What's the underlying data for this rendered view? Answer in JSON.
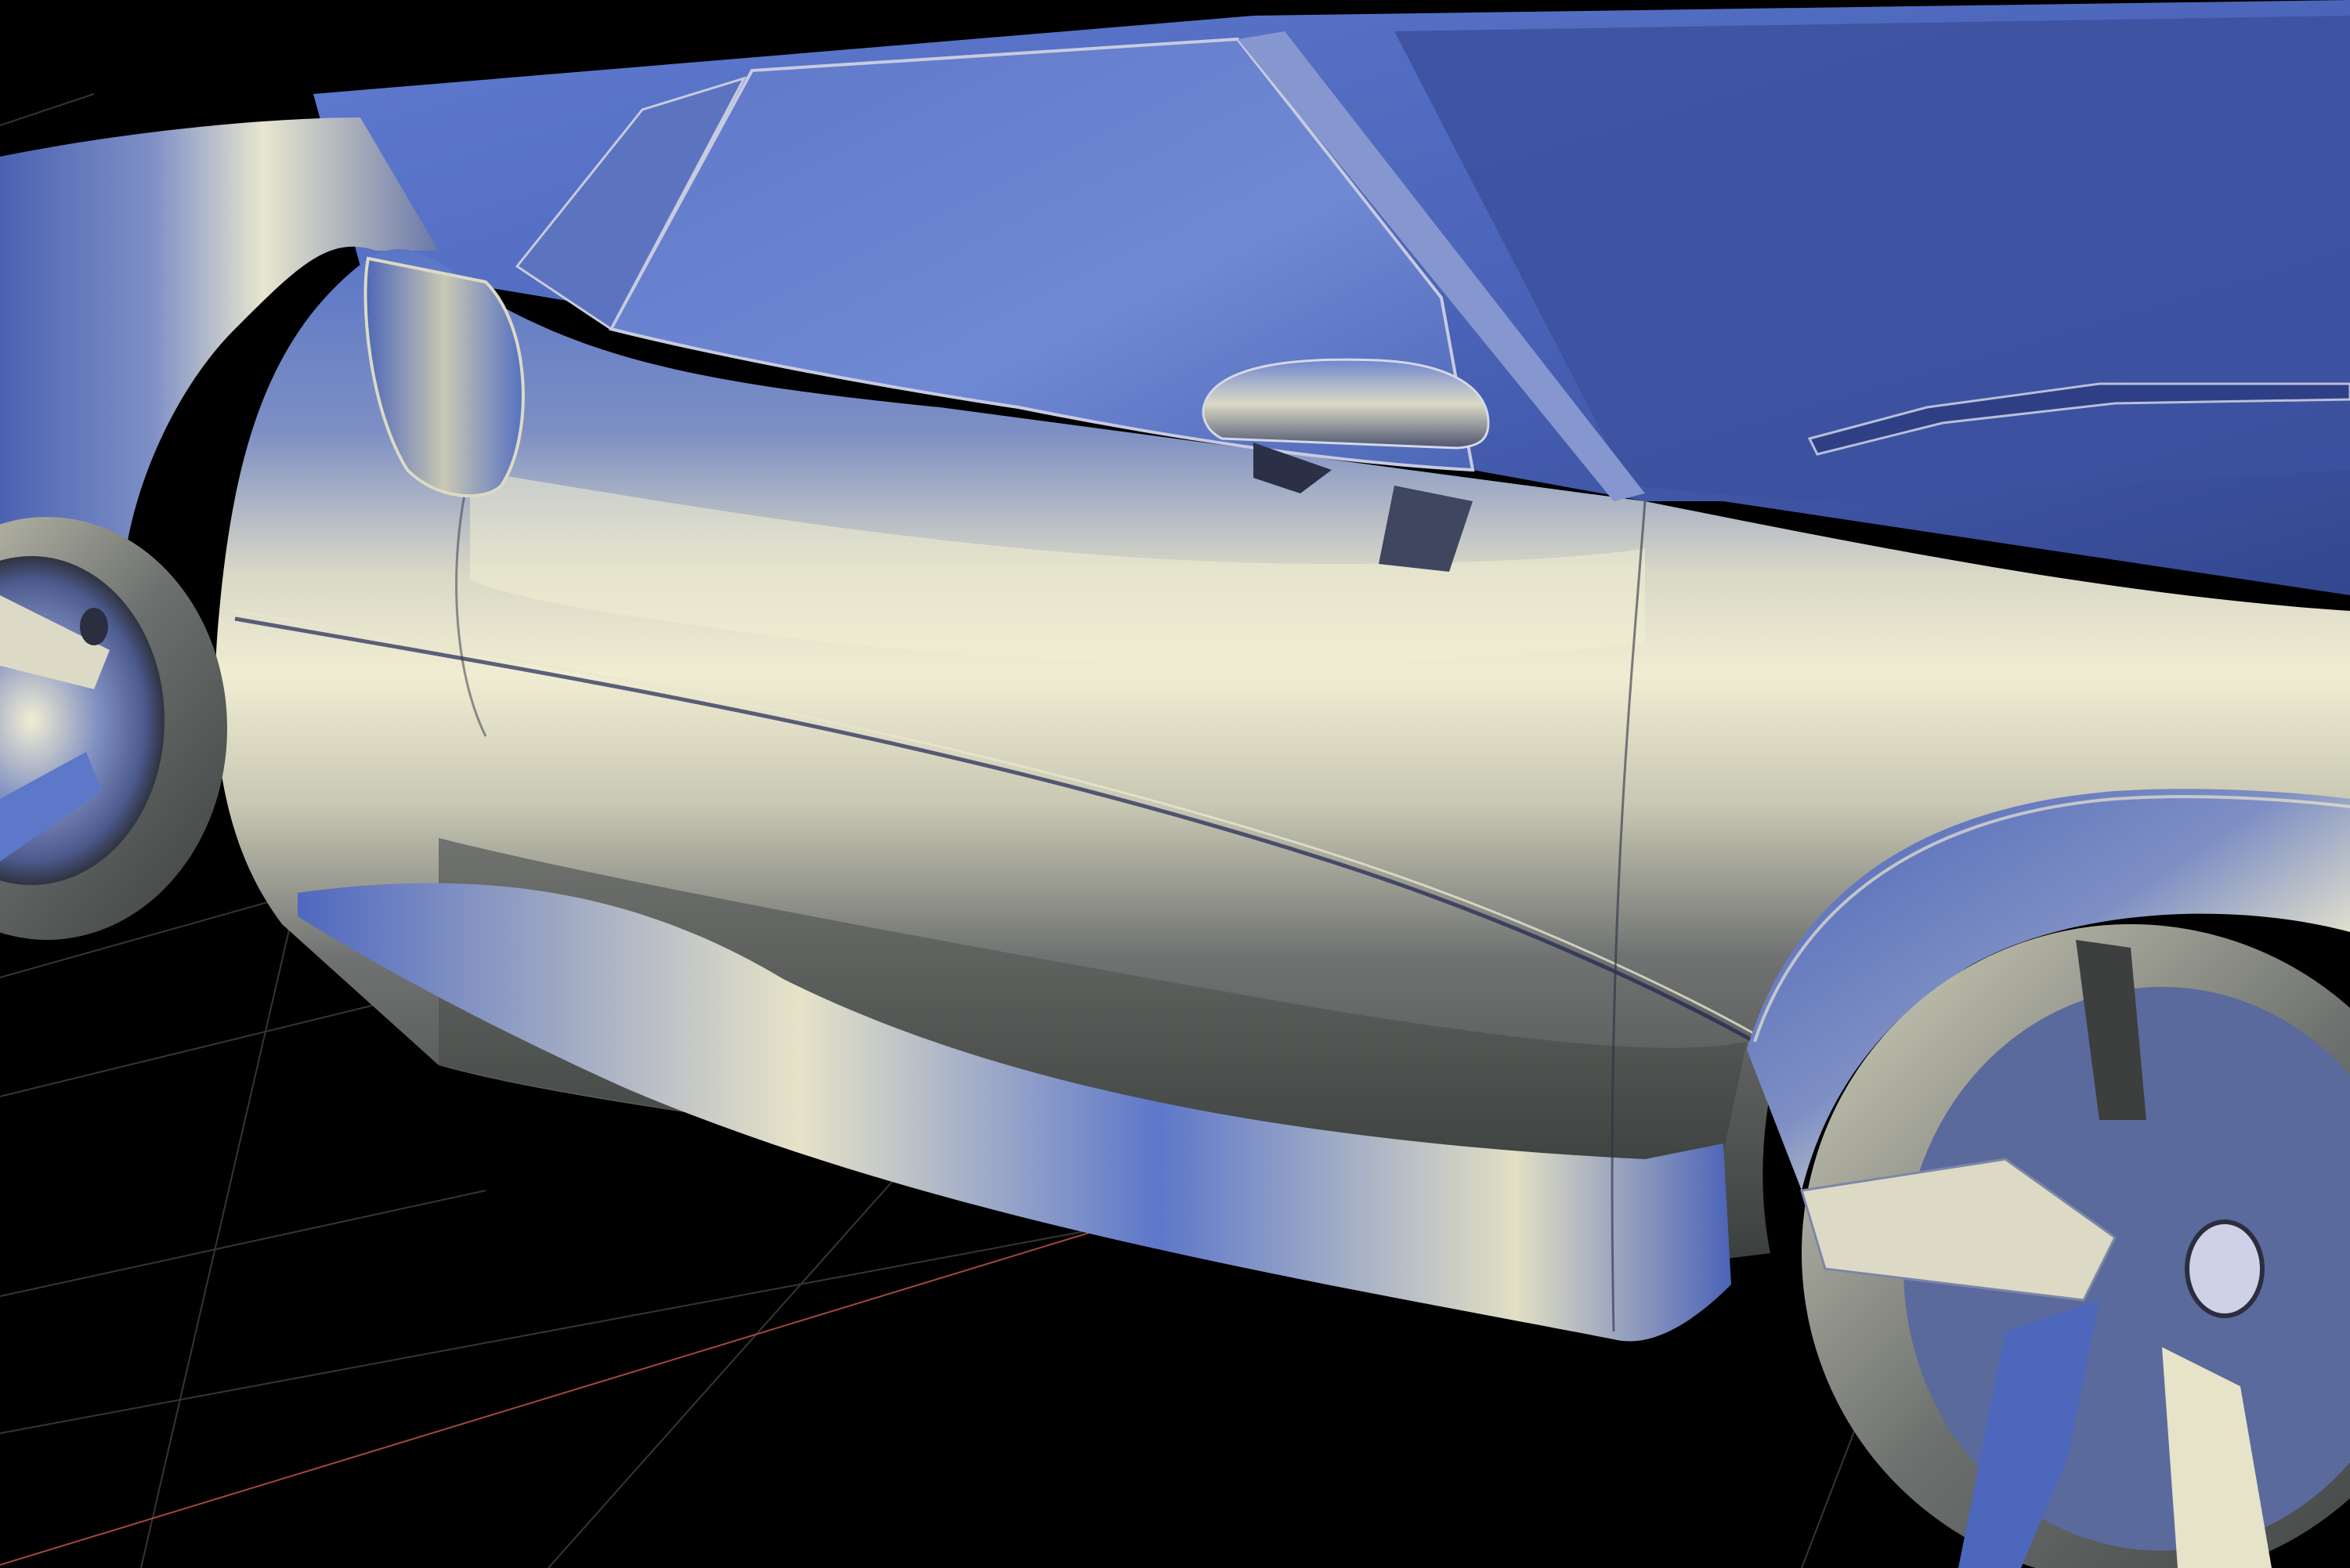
{
  "viewport": {
    "background": "#000000",
    "grid_line_color": "#3a3a3a",
    "axis_line_color": "#b4504a",
    "material_colors": {
      "highlight": "#f3f0d2",
      "sky": "#5a78c8",
      "dark": "#3a3e3c",
      "deep_blue": "#3348a0"
    },
    "subject": "car-side-body"
  }
}
